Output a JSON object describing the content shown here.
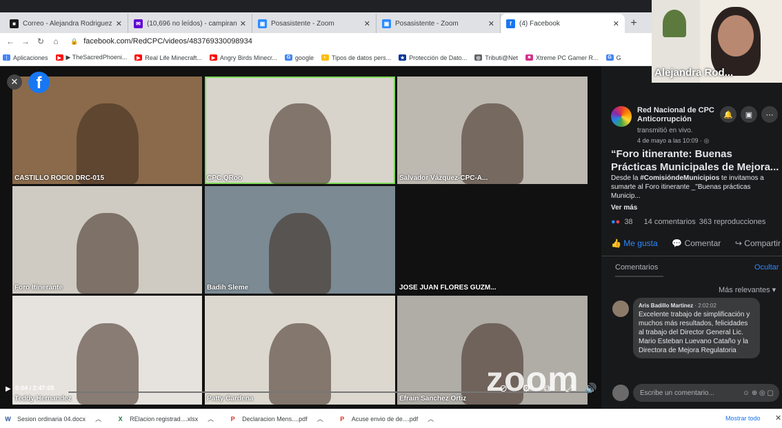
{
  "browser": {
    "tabs": [
      {
        "title": "Correo - Alejandra Rodriguez Ca",
        "color": "#1a1a1a",
        "glyph": "■",
        "active": false
      },
      {
        "title": "(10,696 no leídos) - campiran@y",
        "color": "#6001d2",
        "glyph": "✉",
        "active": false
      },
      {
        "title": "Posasistente - Zoom",
        "color": "#2d8cff",
        "glyph": "▣",
        "active": false
      },
      {
        "title": "Posasistente - Zoom",
        "color": "#2d8cff",
        "glyph": "▣",
        "active": false
      },
      {
        "title": "(4) Facebook",
        "color": "#1877f2",
        "glyph": "f",
        "active": true
      }
    ],
    "new_tab": "+",
    "url": "facebook.com/RedCPC/videos/483769330098934",
    "bookmarks": [
      {
        "label": "Aplicaciones",
        "color": "#4285f4",
        "glyph": "⋮"
      },
      {
        "label": "▶ TheSacredPhoeni...",
        "color": "#ff0000",
        "glyph": "▶"
      },
      {
        "label": "Real Life Minecraft...",
        "color": "#ff0000",
        "glyph": "▶"
      },
      {
        "label": "Angry Birds Minecr...",
        "color": "#ff0000",
        "glyph": "▶"
      },
      {
        "label": "google",
        "color": "#4285f4",
        "glyph": "G"
      },
      {
        "label": "Tipos de datos pers...",
        "color": "#fbbc05",
        "glyph": "◐"
      },
      {
        "label": "Protección de Dato...",
        "color": "#003399",
        "glyph": "★"
      },
      {
        "label": "Tributi@Net",
        "color": "#5f6368",
        "glyph": "◎"
      },
      {
        "label": "Xtreme PC Gamer R...",
        "color": "#d62f8b",
        "glyph": "■"
      },
      {
        "label": "G",
        "color": "#4285f4",
        "glyph": "G"
      }
    ]
  },
  "video": {
    "tiles": [
      {
        "name": "CASTILLO ROCIO DRC-015",
        "bg": "#8a6a4a"
      },
      {
        "name": "CPC.QRoo",
        "bg": "#d8d4cc"
      },
      {
        "name": "Salvador Vázquez-CPC-A...",
        "bg": "#bdb8b0"
      },
      {
        "name": "Foro Itinerante",
        "bg": "#cfcbc2"
      },
      {
        "name": "Badih Sleme",
        "bg": "#7b8a93"
      },
      {
        "name": "JOSE JUAN FLORES GUZM...",
        "bg": "#111111"
      },
      {
        "name": "Teddy Hernandez",
        "bg": "#e6e3de"
      },
      {
        "name": "Patty Cardena",
        "bg": "#dcd8cf"
      },
      {
        "name": "Efrain Sanchez Ortiz",
        "bg": "#b0aca6"
      }
    ],
    "zoom_watermark": "zoom",
    "time": "0:04 / 2:47:05",
    "progress": 0.0004
  },
  "panel": {
    "page_name_1": "Red Nacional de CPC",
    "page_name_2": "Anticorrupción",
    "action": "transmitió en vivo.",
    "date": "4 de mayo a las 10:09 · ",
    "title": "“Foro itinerante: Buenas Prácticas Municipales de Mejora...",
    "desc_pre": "Desde la ",
    "hashtag": "#ComisióndeMunicipios",
    "desc_post": " te invitamos a sumarte al Foro itinerante _\"Buenas prácticas Municip...",
    "see_more": "Ver más",
    "reactions": "38",
    "comments_count": "14 comentarios",
    "views": "363 reproducciones",
    "like": "Me gusta",
    "comment": "Comentar",
    "share": "Compartir",
    "comments_tab": "Comentarios",
    "hide": "Ocultar",
    "sort": "Más relevantes",
    "comment_author": "Aris Badillo Martinez",
    "comment_time": "· 2:02:02",
    "comment_text": "Excelente trabajo de simplificación y muchos más resultados, felicidades al trabajo del Director General Lic. Mario Esteban Luevano Cataño y la Directora de Mejora Regulatoria",
    "write_placeholder": "Escribe un comentario..."
  },
  "pip": {
    "name": "Alejandra Rod..."
  },
  "downloads": {
    "items": [
      {
        "name": "Sesion ordinaria 04.docx",
        "color": "#2b579a",
        "glyph": "W"
      },
      {
        "name": "RElacion registrad....xlsx",
        "color": "#217346",
        "glyph": "X"
      },
      {
        "name": "Declaracion Mens....pdf",
        "color": "#d93025",
        "glyph": "P"
      },
      {
        "name": "Acuse envio de de....pdf",
        "color": "#d93025",
        "glyph": "P"
      }
    ],
    "show_all": "Mostrar todo"
  }
}
